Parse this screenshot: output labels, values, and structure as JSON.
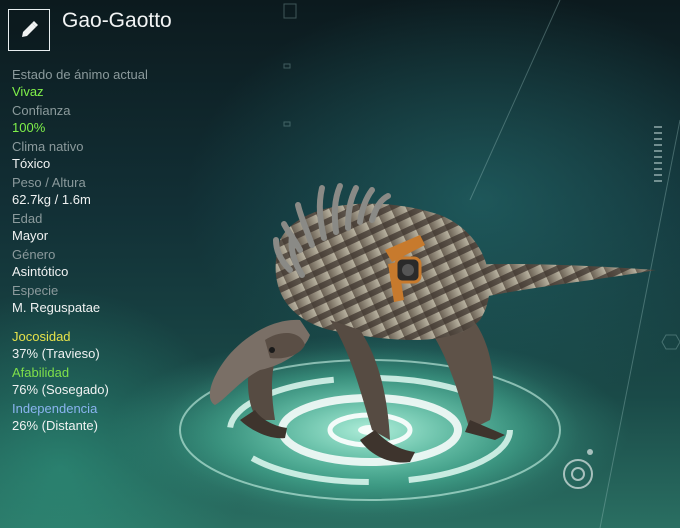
{
  "header": {
    "creature_name": "Gao-Gaotto",
    "edit_icon": "pencil-icon"
  },
  "stats": [
    {
      "label": "Estado de ánimo actual",
      "value": "Vivaz",
      "highlight": true
    },
    {
      "label": "Confianza",
      "value": "100%",
      "highlight": true
    },
    {
      "label": "Clima nativo",
      "value": "Tóxico",
      "highlight": false
    },
    {
      "label": "Peso / Altura",
      "value": "62.7kg / 1.6m",
      "highlight": false
    },
    {
      "label": "Edad",
      "value": "Mayor",
      "highlight": false
    },
    {
      "label": "Género",
      "value": "Asintótico",
      "highlight": false
    },
    {
      "label": "Especie",
      "value": "M. Reguspatae",
      "highlight": false
    }
  ],
  "traits": [
    {
      "label": "Jocosidad",
      "value": "37% (Travieso)",
      "color": "#e6e24a"
    },
    {
      "label": "Afabilidad",
      "value": "76% (Sosegado)",
      "color": "#7fe04a"
    },
    {
      "label": "Independencia",
      "value": "26% (Distante)",
      "color": "#8ab4f0"
    }
  ],
  "colors": {
    "highlight": "#7ff04a",
    "label": "#8b9a9c",
    "value": "#f0f2f2"
  }
}
